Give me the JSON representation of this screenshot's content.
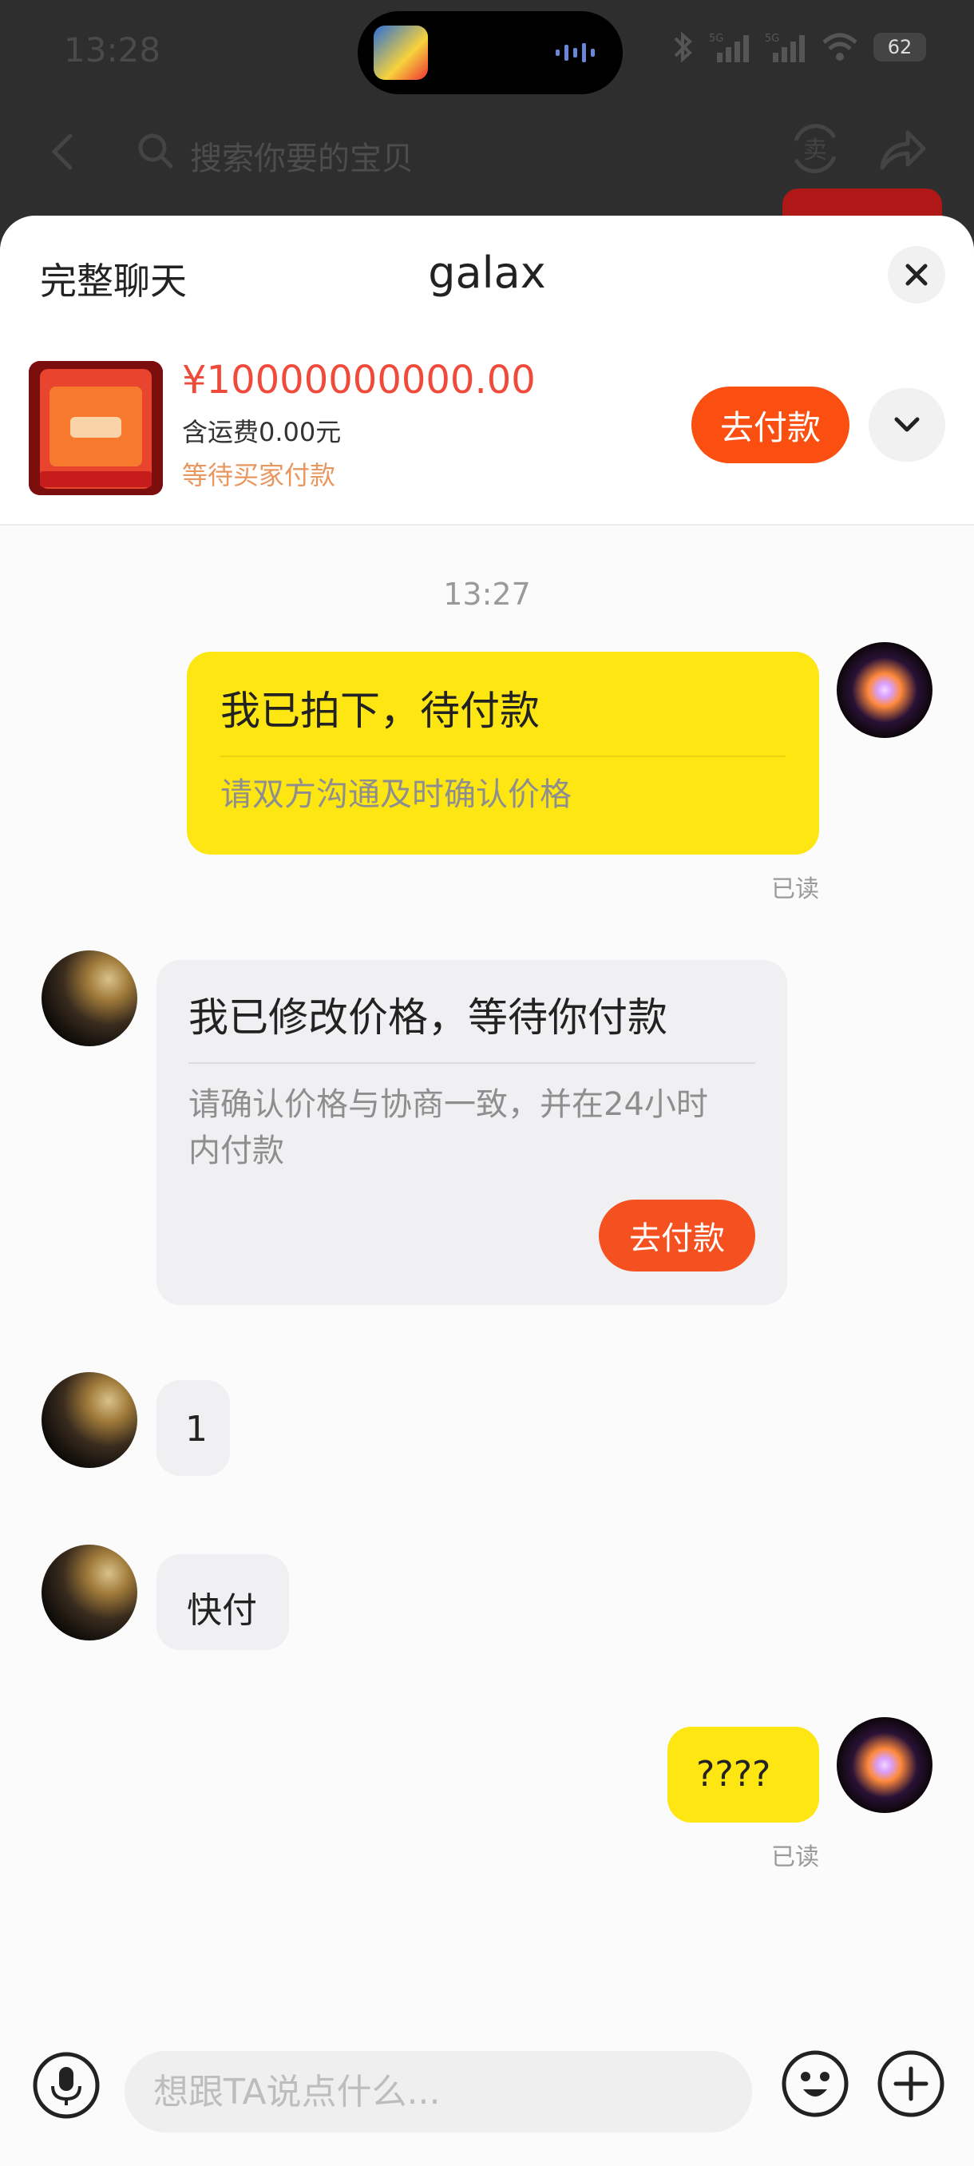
{
  "status_bar": {
    "time": "13:28",
    "battery": "62",
    "network_label": "5G"
  },
  "search_bar": {
    "placeholder": "搜索你要的宝贝",
    "sell_icon_text": "卖"
  },
  "chat_header": {
    "full_chat_label": "完整聊天",
    "title": "galax"
  },
  "order": {
    "price": "¥10000000000.00",
    "shipping": "含运费0.00元",
    "status": "等待买家付款",
    "pay_button": "去付款"
  },
  "messages": {
    "timestamp": "13:27",
    "order_card": {
      "title": "我已拍下，待付款",
      "subtitle": "请双方沟通及时确认价格",
      "read": "已读"
    },
    "price_change_card": {
      "title": "我已修改价格，等待你付款",
      "subtitle": "请确认价格与协商一致，并在24小时内付款",
      "pay_button": "去付款"
    },
    "msg_one": "1",
    "msg_hurry": "快付",
    "msg_question": "????",
    "read_two": "已读"
  },
  "input": {
    "placeholder": "想跟TA说点什么..."
  },
  "colors": {
    "accent_orange": "#fb4f12",
    "price_red": "#ef4a3a",
    "my_bubble": "#fde612",
    "their_bubble": "#f0f0f3"
  }
}
